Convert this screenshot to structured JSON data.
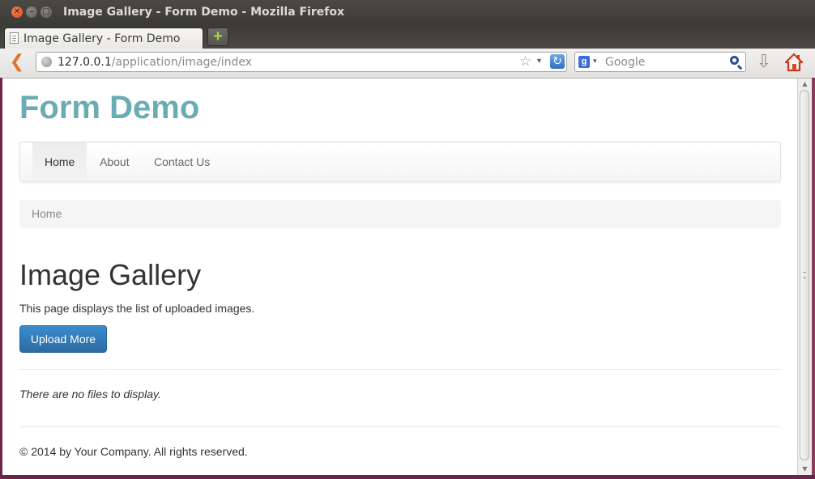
{
  "window": {
    "title": "Image Gallery - Form Demo - Mozilla Firefox",
    "close_glyph": "✕",
    "min_glyph": "–",
    "max_glyph": "□"
  },
  "tab": {
    "label": "Image Gallery - Form Demo",
    "new_tab_glyph": "+"
  },
  "navbar": {
    "back_glyph": "❮",
    "url_host": "127.0.0.1",
    "url_path": "/application/image/index",
    "star_glyph": "☆",
    "dropdown_glyph": "▾",
    "reload_glyph": "↻",
    "search_engine_glyph": "g",
    "search_placeholder": "Google",
    "download_glyph": "⇩"
  },
  "site": {
    "title": "Form Demo",
    "nav": [
      {
        "label": "Home",
        "active": true
      },
      {
        "label": "About",
        "active": false
      },
      {
        "label": "Contact Us",
        "active": false
      }
    ],
    "breadcrumb": "Home"
  },
  "page": {
    "heading": "Image Gallery",
    "description": "This page displays the list of uploaded images.",
    "upload_button": "Upload More",
    "empty_message": "There are no files to display.",
    "footer": "© 2014 by Your Company. All rights reserved."
  },
  "colors": {
    "site_title": "#6aacb3",
    "button": "#337ab7",
    "firefox_back": "#e2722c",
    "home_icon": "#d9462c"
  },
  "icons": [
    "close-icon",
    "minimize-icon",
    "maximize-icon",
    "page-icon",
    "new-tab-icon",
    "back-arrow-icon",
    "globe-icon",
    "star-icon",
    "chevron-down-icon",
    "reload-icon",
    "google-icon",
    "search-icon",
    "download-icon",
    "home-icon"
  ]
}
